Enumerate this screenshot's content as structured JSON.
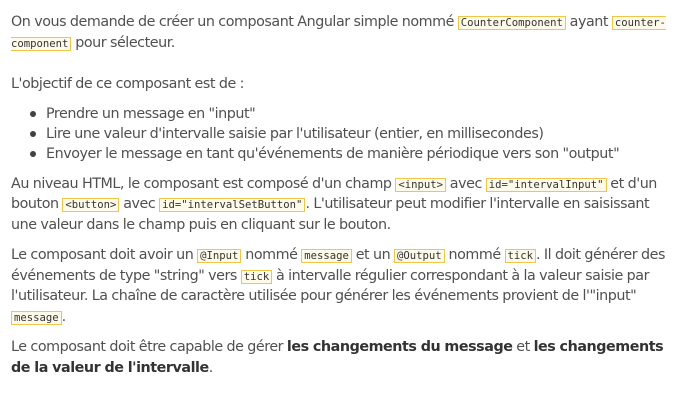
{
  "para1": {
    "t1": "On vous demande de créer un composant Angular simple nommé ",
    "c1": "CounterComponent",
    "t2": " ayant ",
    "c2": "counter-component",
    "t3": " pour sélecteur."
  },
  "para2": {
    "text": "L'objectif de ce composant est de :"
  },
  "list": {
    "items": [
      "Prendre un message en \"input\"",
      "Lire une valeur d'intervalle saisie par l'utilisateur (entier, en millisecondes)",
      "Envoyer le message en tant qu'événements de manière périodique vers son \"output\""
    ]
  },
  "para3": {
    "t1": "Au niveau HTML, le composant est composé d'un champ ",
    "c1": "<input>",
    "t2": " avec ",
    "c2": "id=\"intervalInput\"",
    "t3": " et d'un bouton ",
    "c3": "<button>",
    "t4": " avec ",
    "c4": "id=\"intervalSetButton\"",
    "t5": ". L'utilisateur peut modifier l'intervalle en saisissant une valeur dans le champ puis en cliquant sur le bouton."
  },
  "para4": {
    "t1": "Le composant doit avoir un ",
    "c1": "@Input",
    "t2": " nommé ",
    "c2": "message",
    "t3": " et un ",
    "c3": "@Output",
    "t4": " nommé ",
    "c4": "tick",
    "t5": ". Il doit générer des événements de type \"string\" vers ",
    "c5": "tick",
    "t6": " à intervalle régulier correspondant à la valeur saisie par l'utilisateur. La chaîne de caractère utilisée pour générer les événements provient de l'\"input\" ",
    "c6": "message",
    "t7": "."
  },
  "para5": {
    "t1": "Le composant doit être capable de gérer ",
    "b1": "les changements du message",
    "t2": " et ",
    "b2": "les changements de la valeur de l'intervalle",
    "t3": "."
  },
  "colors": {
    "text": "#505050",
    "code_border": "#f0c64a",
    "code_background": "#fdfaea"
  }
}
